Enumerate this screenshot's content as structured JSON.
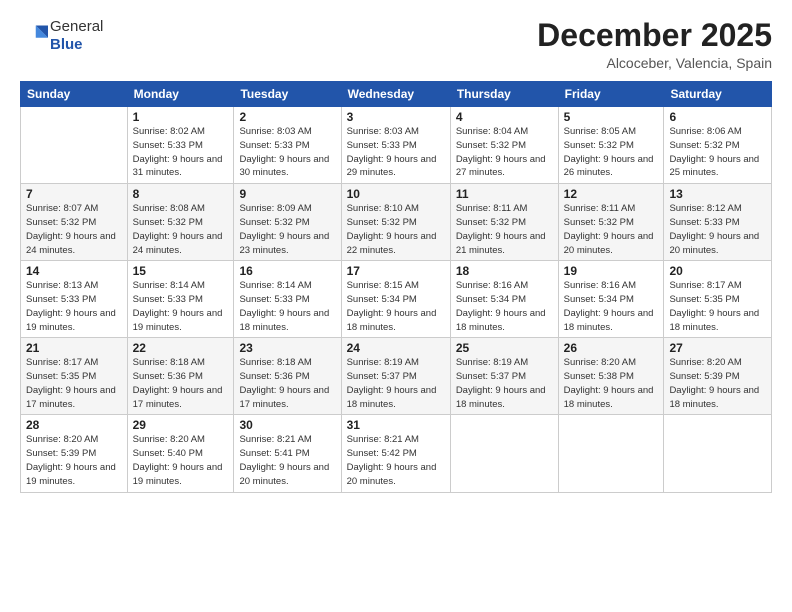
{
  "header": {
    "logo_general": "General",
    "logo_blue": "Blue",
    "month_title": "December 2025",
    "subtitle": "Alcoceber, Valencia, Spain"
  },
  "days_of_week": [
    "Sunday",
    "Monday",
    "Tuesday",
    "Wednesday",
    "Thursday",
    "Friday",
    "Saturday"
  ],
  "weeks": [
    [
      {
        "num": "",
        "sunrise": "",
        "sunset": "",
        "daylight": ""
      },
      {
        "num": "1",
        "sunrise": "Sunrise: 8:02 AM",
        "sunset": "Sunset: 5:33 PM",
        "daylight": "Daylight: 9 hours and 31 minutes."
      },
      {
        "num": "2",
        "sunrise": "Sunrise: 8:03 AM",
        "sunset": "Sunset: 5:33 PM",
        "daylight": "Daylight: 9 hours and 30 minutes."
      },
      {
        "num": "3",
        "sunrise": "Sunrise: 8:03 AM",
        "sunset": "Sunset: 5:33 PM",
        "daylight": "Daylight: 9 hours and 29 minutes."
      },
      {
        "num": "4",
        "sunrise": "Sunrise: 8:04 AM",
        "sunset": "Sunset: 5:32 PM",
        "daylight": "Daylight: 9 hours and 27 minutes."
      },
      {
        "num": "5",
        "sunrise": "Sunrise: 8:05 AM",
        "sunset": "Sunset: 5:32 PM",
        "daylight": "Daylight: 9 hours and 26 minutes."
      },
      {
        "num": "6",
        "sunrise": "Sunrise: 8:06 AM",
        "sunset": "Sunset: 5:32 PM",
        "daylight": "Daylight: 9 hours and 25 minutes."
      }
    ],
    [
      {
        "num": "7",
        "sunrise": "Sunrise: 8:07 AM",
        "sunset": "Sunset: 5:32 PM",
        "daylight": "Daylight: 9 hours and 24 minutes."
      },
      {
        "num": "8",
        "sunrise": "Sunrise: 8:08 AM",
        "sunset": "Sunset: 5:32 PM",
        "daylight": "Daylight: 9 hours and 24 minutes."
      },
      {
        "num": "9",
        "sunrise": "Sunrise: 8:09 AM",
        "sunset": "Sunset: 5:32 PM",
        "daylight": "Daylight: 9 hours and 23 minutes."
      },
      {
        "num": "10",
        "sunrise": "Sunrise: 8:10 AM",
        "sunset": "Sunset: 5:32 PM",
        "daylight": "Daylight: 9 hours and 22 minutes."
      },
      {
        "num": "11",
        "sunrise": "Sunrise: 8:11 AM",
        "sunset": "Sunset: 5:32 PM",
        "daylight": "Daylight: 9 hours and 21 minutes."
      },
      {
        "num": "12",
        "sunrise": "Sunrise: 8:11 AM",
        "sunset": "Sunset: 5:32 PM",
        "daylight": "Daylight: 9 hours and 20 minutes."
      },
      {
        "num": "13",
        "sunrise": "Sunrise: 8:12 AM",
        "sunset": "Sunset: 5:33 PM",
        "daylight": "Daylight: 9 hours and 20 minutes."
      }
    ],
    [
      {
        "num": "14",
        "sunrise": "Sunrise: 8:13 AM",
        "sunset": "Sunset: 5:33 PM",
        "daylight": "Daylight: 9 hours and 19 minutes."
      },
      {
        "num": "15",
        "sunrise": "Sunrise: 8:14 AM",
        "sunset": "Sunset: 5:33 PM",
        "daylight": "Daylight: 9 hours and 19 minutes."
      },
      {
        "num": "16",
        "sunrise": "Sunrise: 8:14 AM",
        "sunset": "Sunset: 5:33 PM",
        "daylight": "Daylight: 9 hours and 18 minutes."
      },
      {
        "num": "17",
        "sunrise": "Sunrise: 8:15 AM",
        "sunset": "Sunset: 5:34 PM",
        "daylight": "Daylight: 9 hours and 18 minutes."
      },
      {
        "num": "18",
        "sunrise": "Sunrise: 8:16 AM",
        "sunset": "Sunset: 5:34 PM",
        "daylight": "Daylight: 9 hours and 18 minutes."
      },
      {
        "num": "19",
        "sunrise": "Sunrise: 8:16 AM",
        "sunset": "Sunset: 5:34 PM",
        "daylight": "Daylight: 9 hours and 18 minutes."
      },
      {
        "num": "20",
        "sunrise": "Sunrise: 8:17 AM",
        "sunset": "Sunset: 5:35 PM",
        "daylight": "Daylight: 9 hours and 18 minutes."
      }
    ],
    [
      {
        "num": "21",
        "sunrise": "Sunrise: 8:17 AM",
        "sunset": "Sunset: 5:35 PM",
        "daylight": "Daylight: 9 hours and 17 minutes."
      },
      {
        "num": "22",
        "sunrise": "Sunrise: 8:18 AM",
        "sunset": "Sunset: 5:36 PM",
        "daylight": "Daylight: 9 hours and 17 minutes."
      },
      {
        "num": "23",
        "sunrise": "Sunrise: 8:18 AM",
        "sunset": "Sunset: 5:36 PM",
        "daylight": "Daylight: 9 hours and 17 minutes."
      },
      {
        "num": "24",
        "sunrise": "Sunrise: 8:19 AM",
        "sunset": "Sunset: 5:37 PM",
        "daylight": "Daylight: 9 hours and 18 minutes."
      },
      {
        "num": "25",
        "sunrise": "Sunrise: 8:19 AM",
        "sunset": "Sunset: 5:37 PM",
        "daylight": "Daylight: 9 hours and 18 minutes."
      },
      {
        "num": "26",
        "sunrise": "Sunrise: 8:20 AM",
        "sunset": "Sunset: 5:38 PM",
        "daylight": "Daylight: 9 hours and 18 minutes."
      },
      {
        "num": "27",
        "sunrise": "Sunrise: 8:20 AM",
        "sunset": "Sunset: 5:39 PM",
        "daylight": "Daylight: 9 hours and 18 minutes."
      }
    ],
    [
      {
        "num": "28",
        "sunrise": "Sunrise: 8:20 AM",
        "sunset": "Sunset: 5:39 PM",
        "daylight": "Daylight: 9 hours and 19 minutes."
      },
      {
        "num": "29",
        "sunrise": "Sunrise: 8:20 AM",
        "sunset": "Sunset: 5:40 PM",
        "daylight": "Daylight: 9 hours and 19 minutes."
      },
      {
        "num": "30",
        "sunrise": "Sunrise: 8:21 AM",
        "sunset": "Sunset: 5:41 PM",
        "daylight": "Daylight: 9 hours and 20 minutes."
      },
      {
        "num": "31",
        "sunrise": "Sunrise: 8:21 AM",
        "sunset": "Sunset: 5:42 PM",
        "daylight": "Daylight: 9 hours and 20 minutes."
      },
      {
        "num": "",
        "sunrise": "",
        "sunset": "",
        "daylight": ""
      },
      {
        "num": "",
        "sunrise": "",
        "sunset": "",
        "daylight": ""
      },
      {
        "num": "",
        "sunrise": "",
        "sunset": "",
        "daylight": ""
      }
    ]
  ]
}
